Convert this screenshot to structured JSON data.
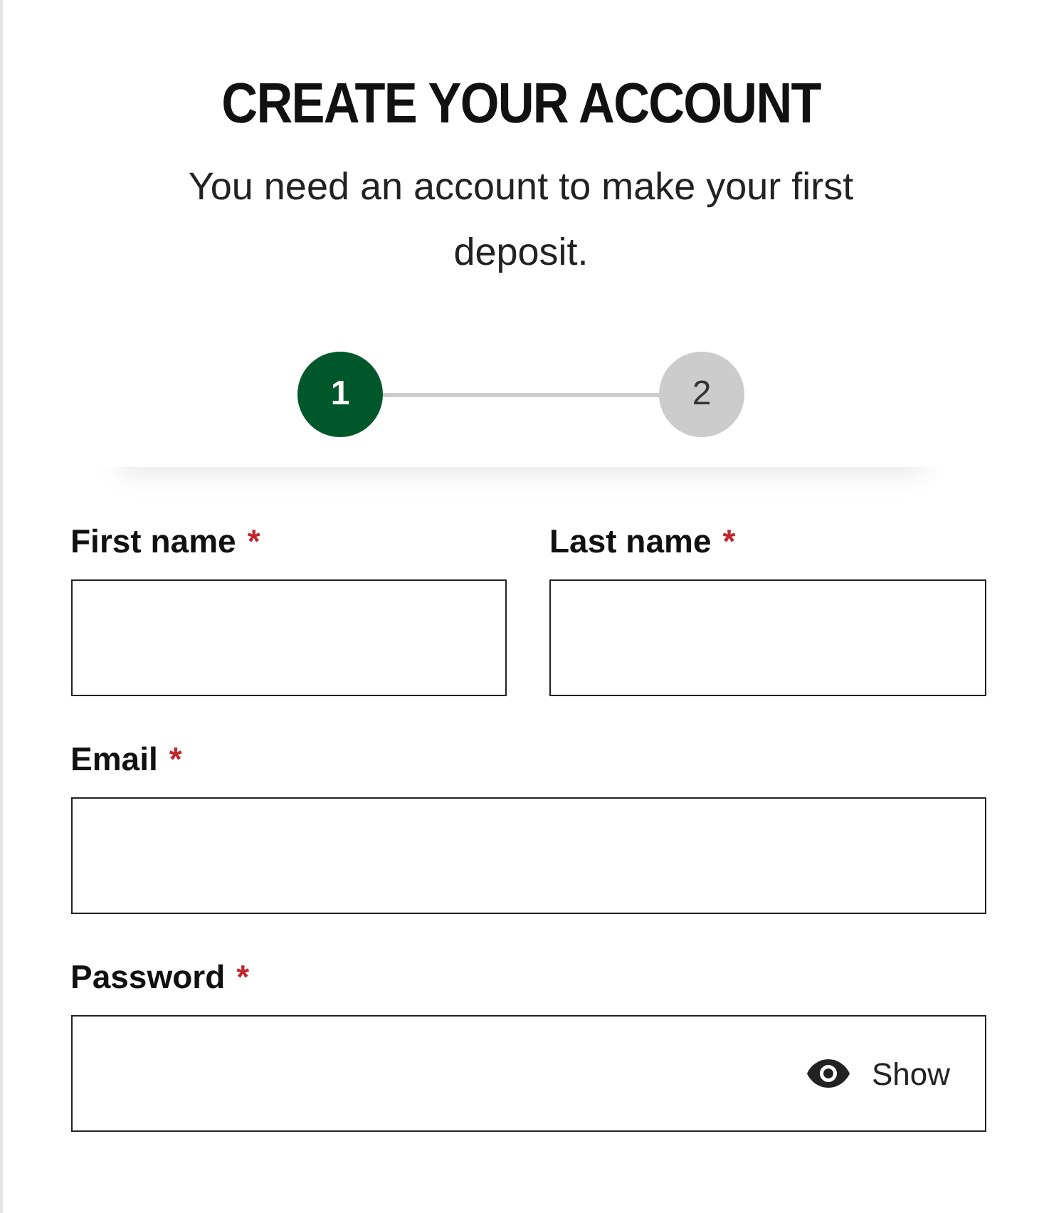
{
  "title": "CREATE YOUR ACCOUNT",
  "subtitle": "You need an account to make your first deposit.",
  "steps": [
    {
      "label": "1",
      "selected": true
    },
    {
      "label": "2",
      "selected": false
    }
  ],
  "fields": [
    {
      "kind": "half",
      "label": "First name",
      "required_mark": "*"
    },
    {
      "kind": "half",
      "label": "Last name",
      "required_mark": "*"
    },
    {
      "kind": "full",
      "label": "Email",
      "required_mark": "*"
    },
    {
      "kind": "password",
      "label": "Password",
      "required_mark": "*",
      "toggle": "Show"
    }
  ]
}
